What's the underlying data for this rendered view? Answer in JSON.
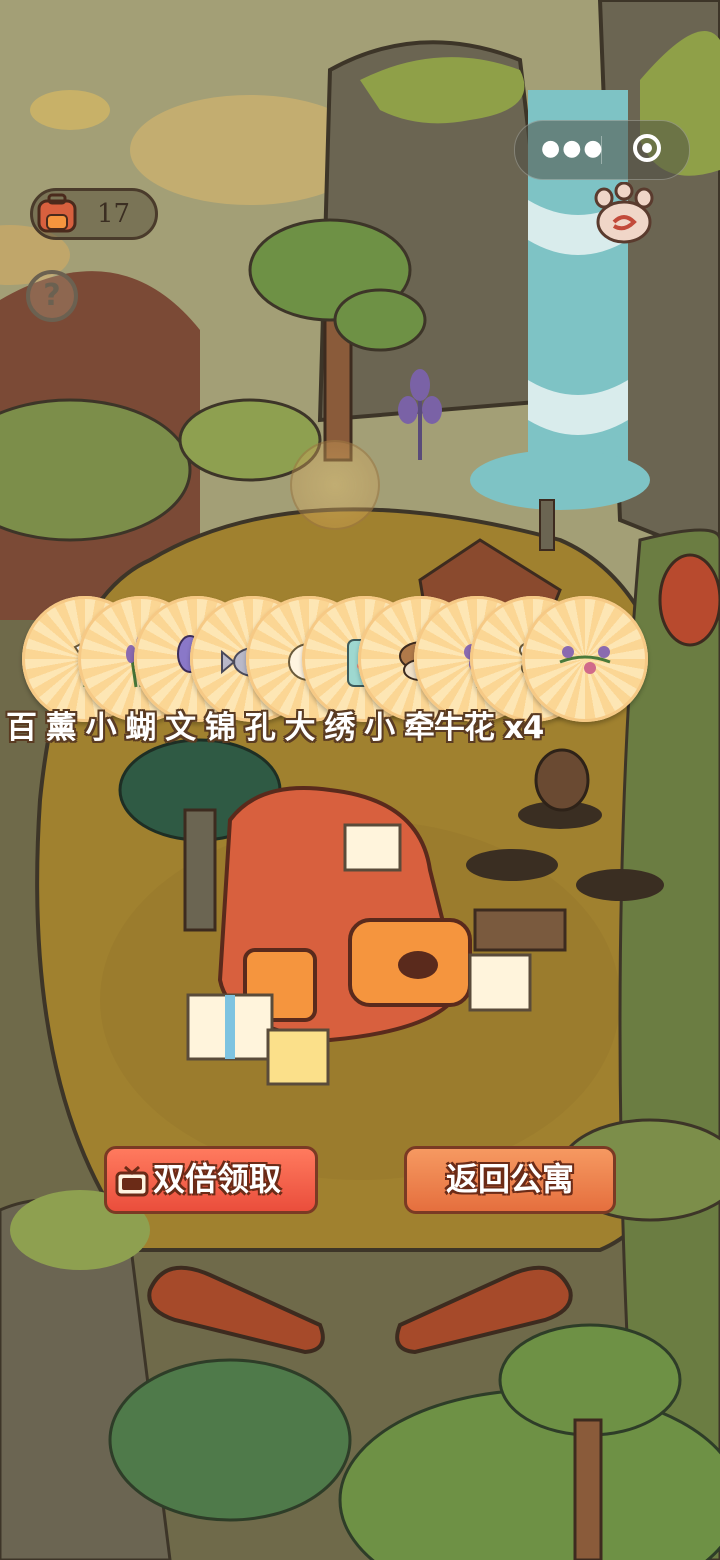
{
  "hud": {
    "backpack_count": "17",
    "help_symbol": "?"
  },
  "rewards": {
    "items": [
      {
        "icon": "lily-flower-icon"
      },
      {
        "icon": "lavender-icon"
      },
      {
        "icon": "butterfly-icon"
      },
      {
        "icon": "fish-icon"
      },
      {
        "icon": "bird-icon"
      },
      {
        "icon": "jar-icon"
      },
      {
        "icon": "sparrow-icon"
      },
      {
        "icon": "hydrangea-icon"
      },
      {
        "icon": "jasmine-icon"
      },
      {
        "icon": "morning-glory-icon"
      }
    ],
    "label": "百 薰 小 蝴 文 锦 孔 大 绣 小 牵牛花 x4"
  },
  "buttons": {
    "double_label": "双倍领取",
    "return_label": "返回公寓"
  },
  "colors": {
    "double_button": "#ea4e3c",
    "return_button": "#e56f3e",
    "coin": "#fbd694"
  }
}
